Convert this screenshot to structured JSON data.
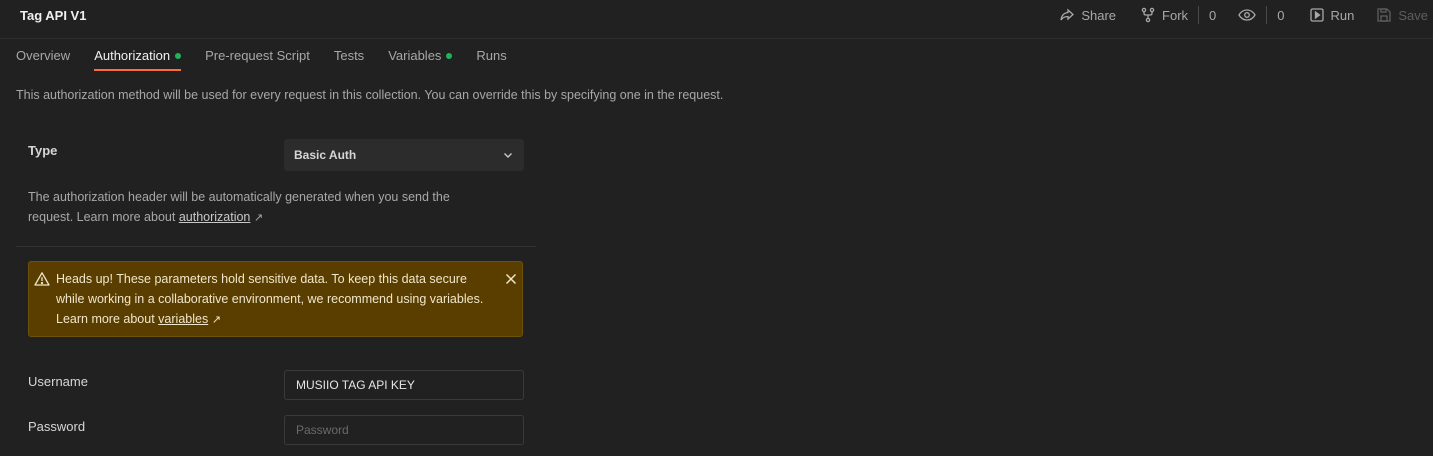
{
  "header": {
    "title": "Tag API V1",
    "share_label": "Share",
    "fork_label": "Fork",
    "fork_count": "0",
    "watch_count": "0",
    "run_label": "Run",
    "save_label": "Save"
  },
  "tabs": [
    {
      "label": "Overview",
      "active": false,
      "dot": false
    },
    {
      "label": "Authorization",
      "active": true,
      "dot": true
    },
    {
      "label": "Pre-request Script",
      "active": false,
      "dot": false
    },
    {
      "label": "Tests",
      "active": false,
      "dot": false
    },
    {
      "label": "Variables",
      "active": false,
      "dot": true
    },
    {
      "label": "Runs",
      "active": false,
      "dot": false
    }
  ],
  "description": "This authorization method will be used for every request in this collection. You can override this by specifying one in the request.",
  "auth": {
    "type_label": "Type",
    "type_value": "Basic Auth",
    "help_text": "The authorization header will be automatically generated when you send the request. Learn more about",
    "help_link": "authorization",
    "warning_text": "Heads up! These parameters hold sensitive data. To keep this data secure while working in a collaborative environment, we recommend using variables. Learn more about",
    "warning_link": "variables",
    "username_label": "Username",
    "username_value": "MUSIIO TAG API KEY",
    "password_label": "Password",
    "password_placeholder": "Password"
  },
  "colors": {
    "accent": "#ff6c37",
    "dot_green": "#20b35a",
    "warning_bg": "#5a3e00"
  },
  "icons": [
    "share-icon",
    "fork-icon",
    "eye-icon",
    "run-icon",
    "save-icon",
    "chevron-down-icon",
    "warning-icon",
    "close-icon"
  ]
}
